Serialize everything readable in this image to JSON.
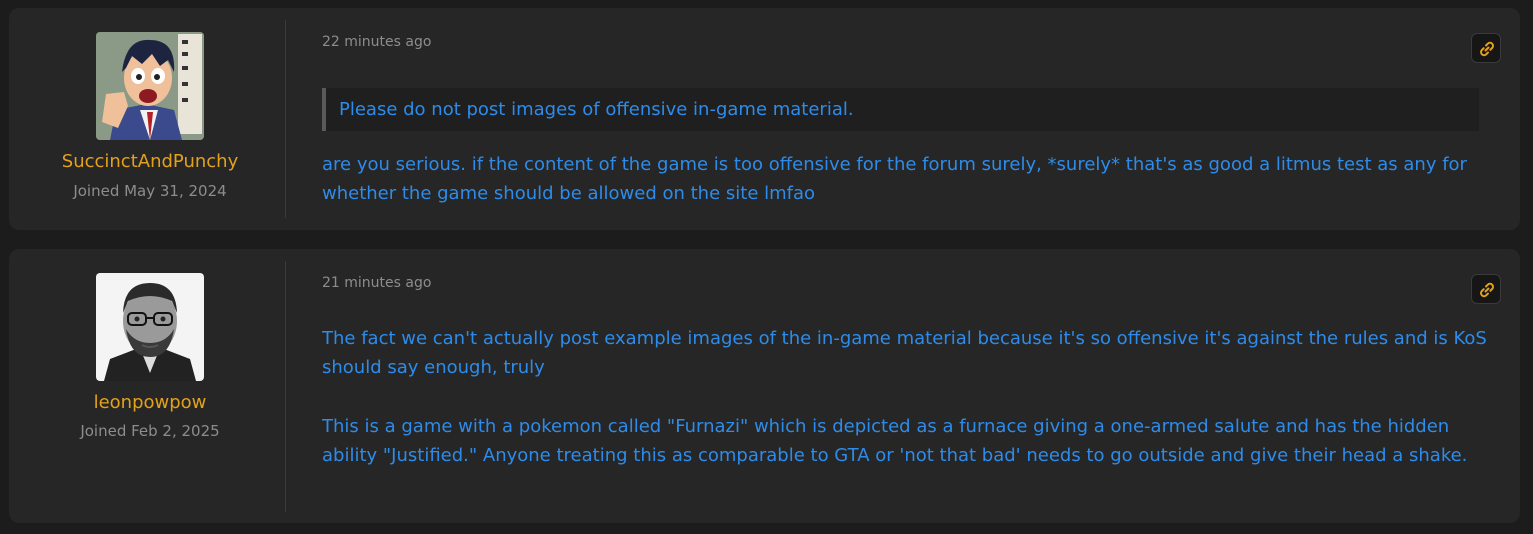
{
  "posts": [
    {
      "author": {
        "username": "SuccinctAndPunchy",
        "joined": "Joined May 31, 2024",
        "avatar_icon": "anime-character-avatar"
      },
      "timestamp": "22 minutes ago",
      "permalink_icon": "link-icon",
      "quote": "Please do not post images of offensive in-game material.",
      "paragraphs": [
        "are you serious. if the content of the game is too offensive for the forum surely, *surely* that's as good a litmus test as any for whether the game should be allowed on the site lmfao"
      ]
    },
    {
      "author": {
        "username": "leonpowpow",
        "joined": "Joined Feb 2, 2025",
        "avatar_icon": "grayscale-portrait-avatar"
      },
      "timestamp": "21 minutes ago",
      "permalink_icon": "link-icon",
      "quote": "",
      "paragraphs": [
        "The fact we can't actually post example images of the in-game material because it's so offensive it's against the rules and is KoS should say enough, truly",
        "This is a game with a pokemon called \"Furnazi\" which is depicted as a furnace giving a one-armed salute and has the hidden ability \"Justified.\" Anyone treating this as comparable to GTA or 'not that bad' needs to go outside and give their head a shake."
      ]
    }
  ],
  "colors": {
    "page_bg": "#1c1c1c",
    "card_bg": "#262626",
    "username": "#e4a11b",
    "body_text": "#2d8ceb",
    "muted": "#8d8d8d",
    "link_icon": "#e4a11b"
  }
}
